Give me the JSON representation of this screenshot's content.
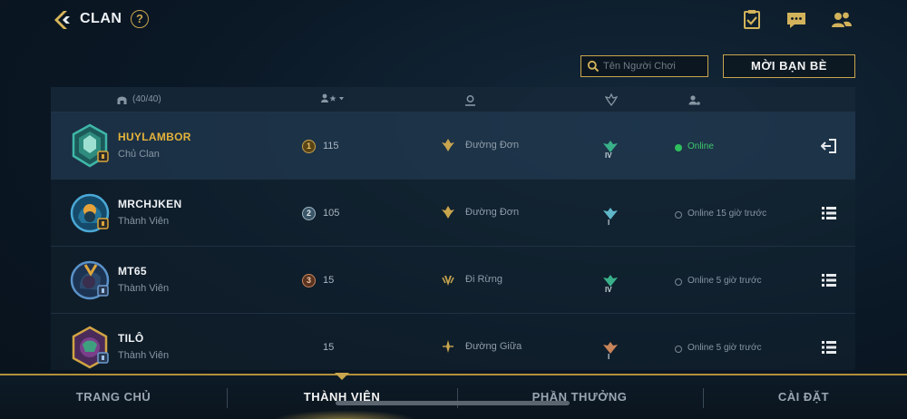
{
  "header": {
    "title": "CLAN",
    "help_label": "?",
    "icons": [
      "clipboard-check-icon",
      "chat-icon",
      "friends-icon"
    ]
  },
  "search": {
    "placeholder": "Tên Người Chơi"
  },
  "invite_button": "MỜI BẠN BÈ",
  "table": {
    "member_count": "(40/40)",
    "columns": [
      "member-count",
      "points-sort",
      "position",
      "rank",
      "status"
    ]
  },
  "members": [
    {
      "name": "HUYLAMBOR",
      "role": "Chủ Clan",
      "rank_no": "1",
      "points": "115",
      "position": "Đường Đơn",
      "tier": "IV",
      "status": "Online",
      "online": true,
      "action_icon": "leave-icon"
    },
    {
      "name": "MRCHJKEN",
      "role": "Thành Viên",
      "rank_no": "2",
      "points": "105",
      "position": "Đường Đơn",
      "tier": "I",
      "status": "Online 15 giờ trước",
      "online": false,
      "action_icon": "menu-icon"
    },
    {
      "name": "MT65",
      "role": "Thành Viên",
      "rank_no": "3",
      "points": "15",
      "position": "Đi Rừng",
      "tier": "IV",
      "status": "Online 5 giờ trước",
      "online": false,
      "action_icon": "menu-icon"
    },
    {
      "name": "TILÔ",
      "role": "Thành Viên",
      "rank_no": "",
      "points": "15",
      "position": "Đường Giữa",
      "tier": "I",
      "status": "Online 5 giờ trước",
      "online": false,
      "action_icon": "menu-icon"
    }
  ],
  "nav": {
    "items": [
      "TRANG CHỦ",
      "THÀNH VIÊN",
      "PHẦN THƯỞNG",
      "CÀI ĐẶT"
    ],
    "active": "THÀNH VIÊN"
  },
  "colors": {
    "accent_gold": "#c9a54d",
    "leader_name": "#e5b33a",
    "online_green": "#2fbf5e"
  }
}
